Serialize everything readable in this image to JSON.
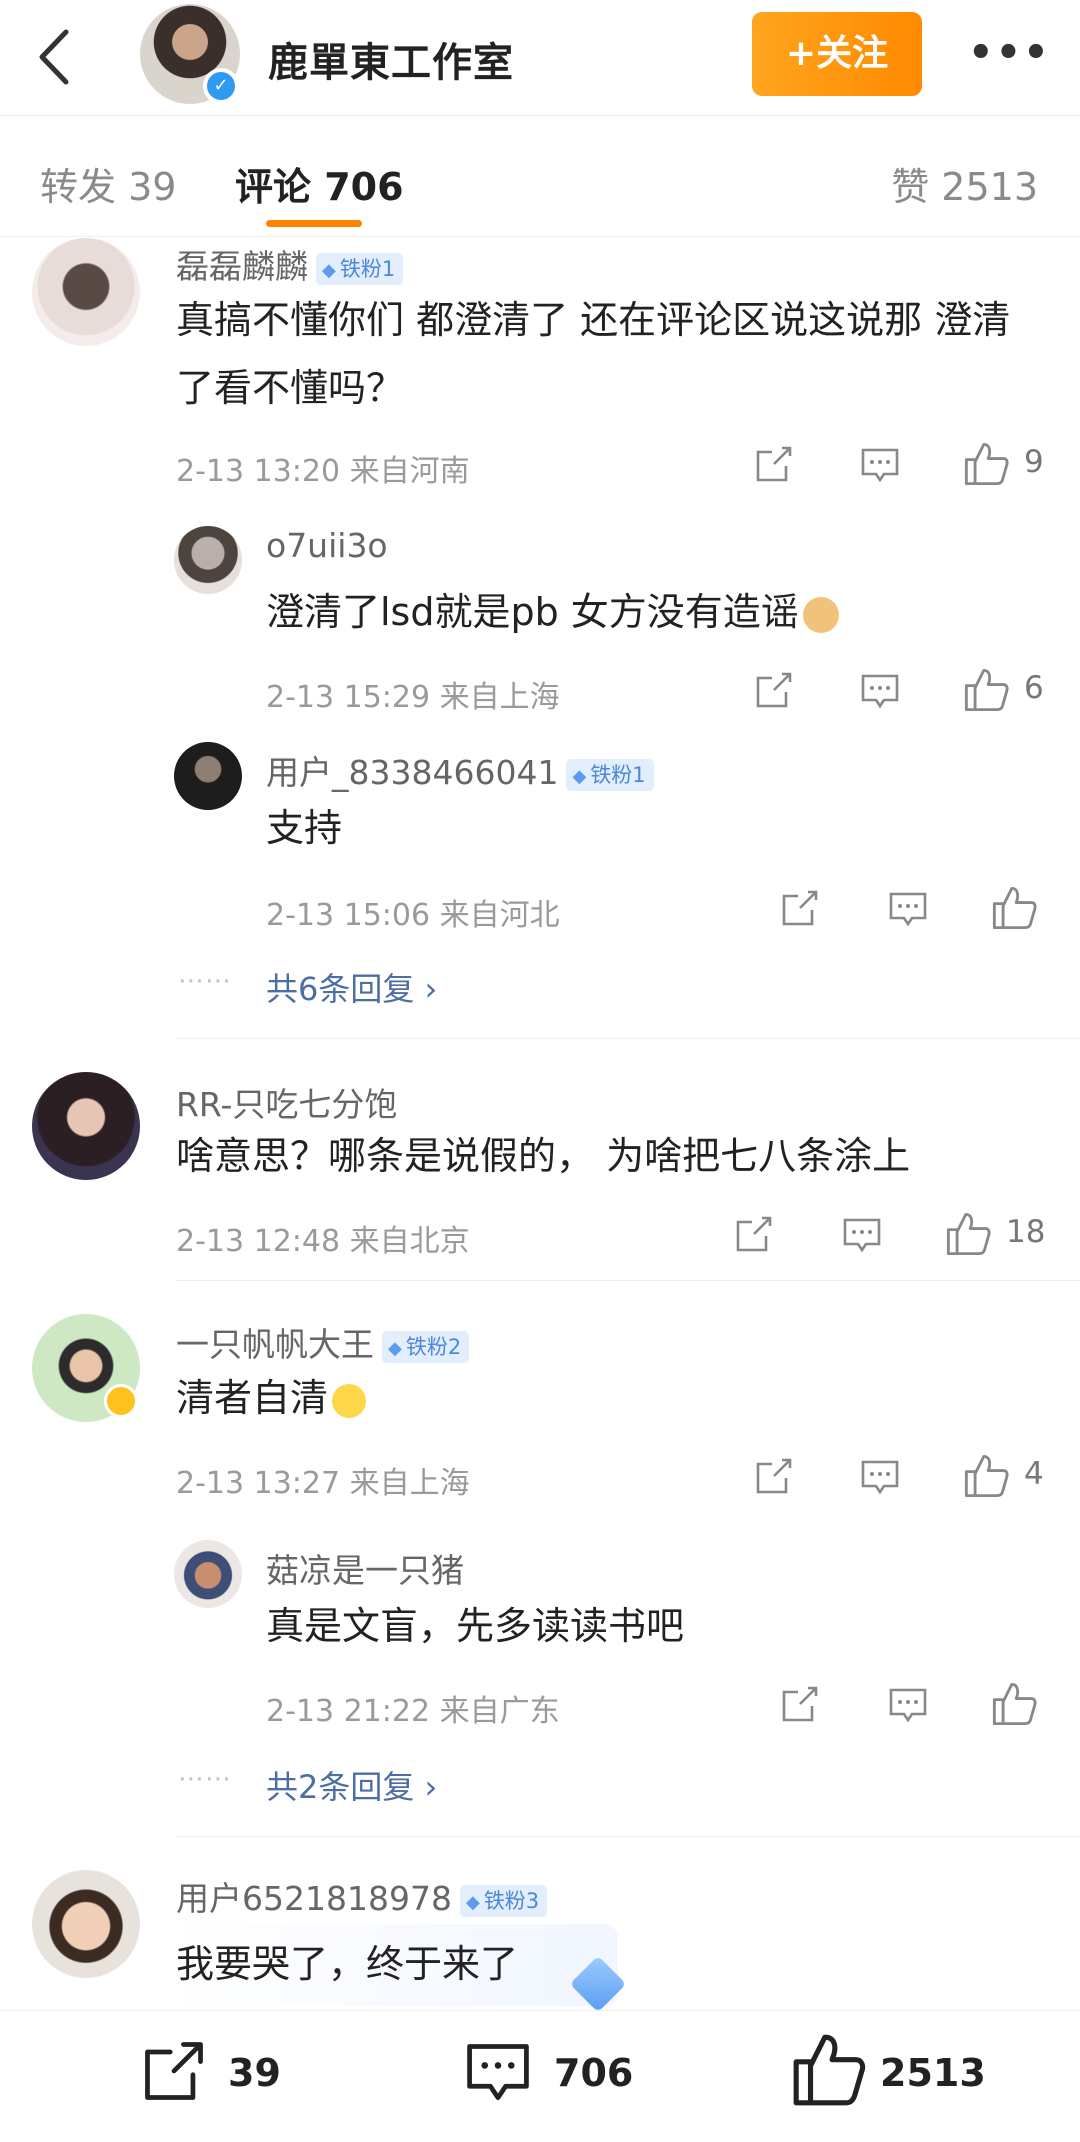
{
  "header": {
    "title": "鹿單東工作室",
    "follow_label": "+关注",
    "more_label": "•••",
    "verified_mark": "✓"
  },
  "tabs": {
    "repost": "转发 39",
    "comment": "评论 706",
    "like": "赞 2513"
  },
  "comments": [
    {
      "user": "磊磊麟麟",
      "badge": "铁粉1",
      "text_line1": "真搞不懂你们 都澄清了 还在评论区说这说那 澄清",
      "text_line2": "了看不懂吗？",
      "meta": "2-13 13:20  来自河南",
      "likes": "9",
      "replies": [
        {
          "user": "o7uii3o",
          "text": "澄清了lsd就是pb 女方没有造谣",
          "meta": "2-13 15:29  来自上海",
          "likes": "6"
        },
        {
          "user": "用户_8338466041",
          "badge": "铁粉1",
          "text": "支持",
          "meta": "2-13 15:06  来自河北",
          "likes": ""
        }
      ],
      "more_replies": "共6条回复 ›"
    },
    {
      "user": "RR-只吃七分饱",
      "text_line1": "啥意思？哪条是说假的， 为啥把七八条涂上",
      "meta": "2-13 12:48  来自北京",
      "likes": "18"
    },
    {
      "user": "一只帆帆大王",
      "badge": "铁粉2",
      "text_line1": "清者自清",
      "meta": "2-13 13:27  来自上海",
      "likes": "4",
      "replies": [
        {
          "user": "菇凉是一只猪",
          "text": "真是文盲，先多读读书吧",
          "meta": "2-13 21:22  来自广东",
          "likes": ""
        }
      ],
      "more_replies": "共2条回复 ›"
    },
    {
      "user": "用户6521818978",
      "badge": "铁粉3",
      "text_line1": "我要哭了，终于来了"
    }
  ],
  "dots": "⋯⋯",
  "bottom_bar": {
    "repost_count": "39",
    "comment_count": "706",
    "like_count": "2513"
  },
  "colors": {
    "accent": "#ff8200",
    "link": "#4d6ea4",
    "badge_bg": "#e3eefc"
  }
}
